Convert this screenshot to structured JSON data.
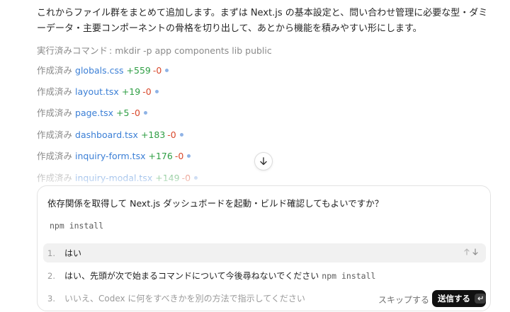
{
  "intro": {
    "text": "これからファイル群をまとめて追加します。まずは Next.js の基本設定と、問い合わせ管理に必要な型・ダミーデータ・主要コンポーネントの骨格を切り出して、あとから機能を積みやすい形にします。"
  },
  "command": {
    "label": "実行済みコマンド",
    "separator": ":",
    "value": "mkdir -p app components lib public"
  },
  "files": [
    {
      "verb": "作成済み",
      "name": "globals.css",
      "added": "+559",
      "removed": "-0"
    },
    {
      "verb": "作成済み",
      "name": "layout.tsx",
      "added": "+19",
      "removed": "-0"
    },
    {
      "verb": "作成済み",
      "name": "page.tsx",
      "added": "+5",
      "removed": "-0"
    },
    {
      "verb": "作成済み",
      "name": "dashboard.tsx",
      "added": "+183",
      "removed": "-0"
    },
    {
      "verb": "作成済み",
      "name": "inquiry-form.tsx",
      "added": "+176",
      "removed": "-0"
    },
    {
      "verb": "作成済み",
      "name": "inquiry-modal.tsx",
      "added": "+149",
      "removed": "-0"
    }
  ],
  "prompt": {
    "question": "依存関係を取得して Next.js ダッシュボードを起動・ビルド確認してもよいですか？",
    "command": "npm install",
    "options": [
      {
        "num": "1.",
        "label": "はい",
        "code": ""
      },
      {
        "num": "2.",
        "label": "はい、先頭が次で始まるコマンドについて今後尋ねないでください",
        "code": "npm install"
      },
      {
        "num": "3.",
        "label": "いいえ、Codex に何をすべきかを別の方法で指示してください",
        "code": ""
      }
    ],
    "skip_label": "スキップする",
    "send_label": "送信する"
  },
  "colors": {
    "link": "#3b7fd6",
    "added": "#2f9e44",
    "removed": "#d9482b",
    "send_bg": "#111111"
  },
  "icons": {
    "scroll": "arrow-down-icon",
    "nav": [
      "arrow-up-icon",
      "arrow-down-icon"
    ],
    "enter": "enter-key-icon"
  }
}
